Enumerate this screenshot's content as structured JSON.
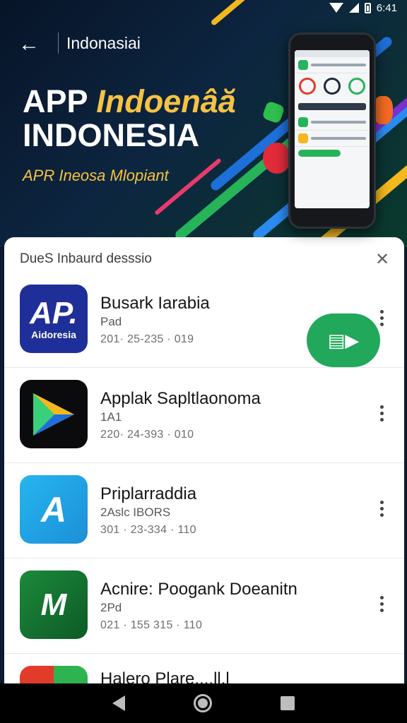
{
  "status_bar": {
    "time": "6:41"
  },
  "header": {
    "back_label": "←",
    "title": "Indonasiai"
  },
  "hero": {
    "headline_part1": "APP ",
    "headline_accent": "Indoenâă",
    "headline_line2": "INDONESIA",
    "tagline": "APR Ineosa Mlopiant"
  },
  "sheet": {
    "title": "DueS Inbaurd desssio",
    "close_label": "✕",
    "install_label": "▤▶"
  },
  "apps": [
    {
      "name": "Busark Iarabia",
      "sub": "Pad",
      "meta": "201· 25-235 · 019",
      "icon_text_big": "AP.",
      "icon_text_small": "Aidoresia"
    },
    {
      "name": "Applak Sapltlaonoma",
      "sub": "1A1",
      "meta": "220· 24-393 · 010"
    },
    {
      "name": "Priplarraddia",
      "sub": "2Aslc IBORS",
      "meta": "301 · 23-334 · 110",
      "icon_text": "A"
    },
    {
      "name": "Acnire: Poogank Doeanitn",
      "sub": "2Pd",
      "meta": "021 · 155 315 · 110",
      "icon_text": "M"
    },
    {
      "name": "Halero Plare....ll.l",
      "sub": "",
      "meta": ""
    }
  ],
  "colors": {
    "accent_yellow": "#f5c242",
    "install_green": "#21a85a",
    "hero_bg": "#0d2540"
  },
  "icons": [
    "back-arrow-icon",
    "wifi-icon",
    "signal-icon",
    "battery-icon",
    "close-icon",
    "more-vert-icon",
    "nav-back-icon",
    "nav-home-icon",
    "nav-recent-icon"
  ]
}
